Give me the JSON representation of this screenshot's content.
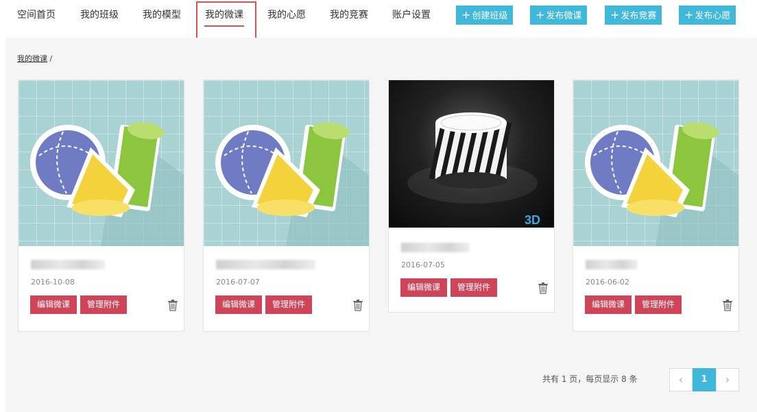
{
  "nav": {
    "items": [
      {
        "label": "空间首页"
      },
      {
        "label": "我的班级"
      },
      {
        "label": "我的模型"
      },
      {
        "label": "我的微课"
      },
      {
        "label": "我的心愿"
      },
      {
        "label": "我的竞赛"
      },
      {
        "label": "账户设置"
      }
    ],
    "active_index": 3,
    "buttons": [
      {
        "plus": "+",
        "label": "创建班级"
      },
      {
        "plus": "+",
        "label": "发布微课"
      },
      {
        "plus": "+",
        "label": "发布竞赛"
      },
      {
        "plus": "+",
        "label": "发布心愿"
      }
    ]
  },
  "breadcrumb": {
    "link": "我的微课",
    "sep": " /"
  },
  "cards": [
    {
      "date": "2016-10-08",
      "edit_label": "编辑微课",
      "attach_label": "管理附件",
      "thumb": "geometry-shapes"
    },
    {
      "date": "2016-07-07",
      "edit_label": "编辑微课",
      "attach_label": "管理附件",
      "thumb": "geometry-shapes"
    },
    {
      "date": "2016-07-05",
      "edit_label": "编辑微课",
      "attach_label": "管理附件",
      "thumb": "3d-printed-lamp",
      "watermark": "3D"
    },
    {
      "date": "2016-06-02",
      "edit_label": "编辑微课",
      "attach_label": "管理附件",
      "thumb": "geometry-shapes"
    }
  ],
  "pager": {
    "summary": "共有 1 页，每页显示 8 条",
    "prev": "‹",
    "current": "1",
    "next": "›"
  },
  "colors": {
    "accent": "#3fb8d9",
    "danger": "#cf4459",
    "highlight": "#d9534f"
  }
}
